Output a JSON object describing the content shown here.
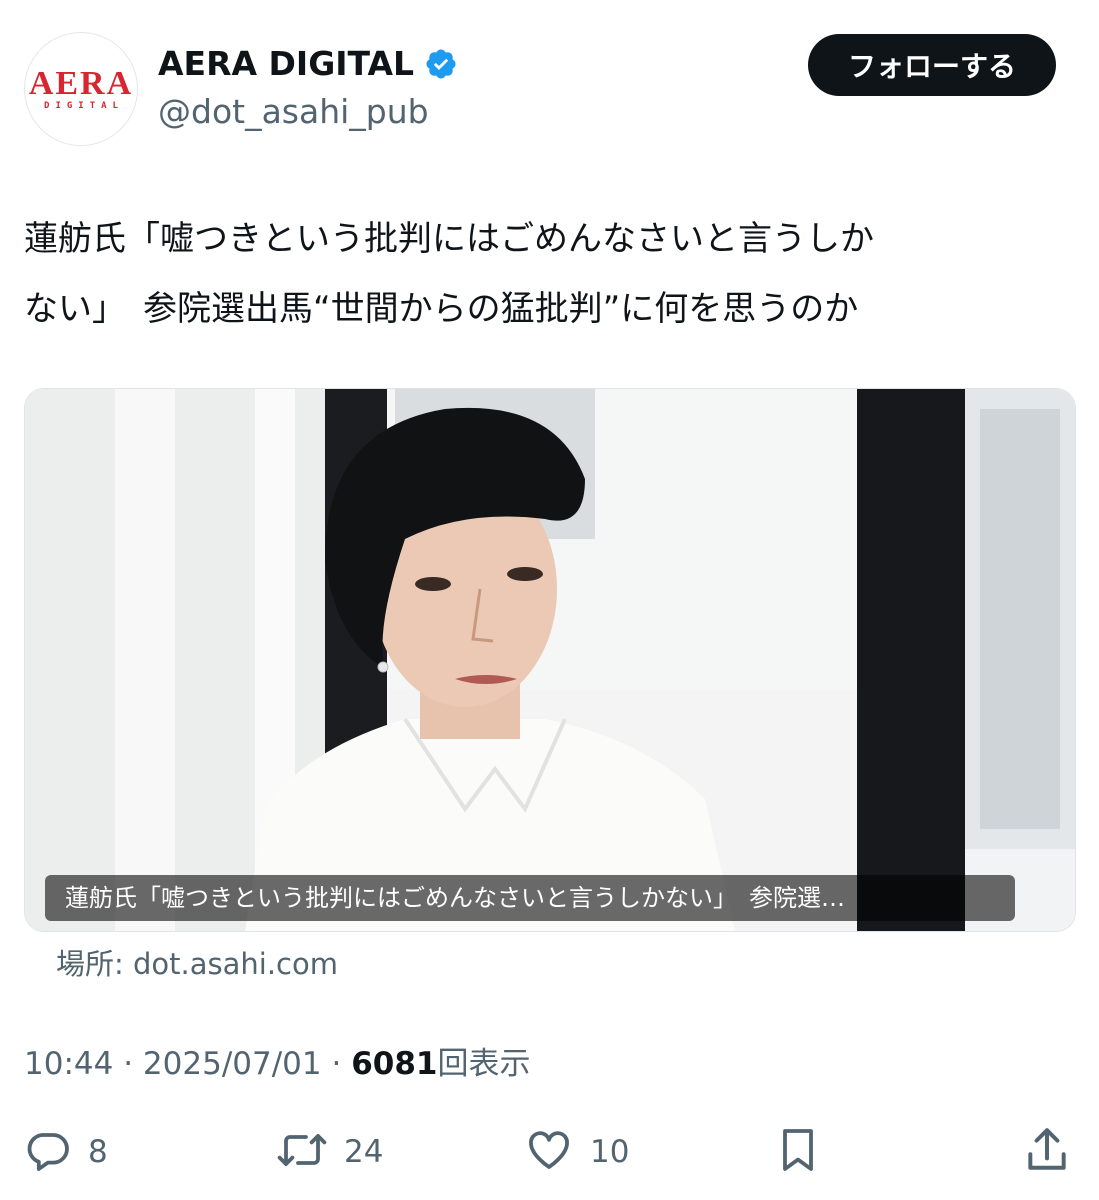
{
  "account": {
    "avatar_logo_main": "AERA",
    "avatar_logo_sub": "DIGITAL",
    "display_name": "AERA DIGITAL",
    "handle": "@dot_asahi_pub",
    "verified": true
  },
  "follow_button": {
    "label": "フォローする"
  },
  "tweet": {
    "text": "蓮舫氏「嘘つきという批判にはごめんなさいと言うしか\nない」　参院選出馬“世間からの猛批判”に何を思うのか"
  },
  "link_card": {
    "image_description_icon": "photo",
    "caption": "蓮舫氏「嘘つきという批判にはごめんなさいと言うしかない」　参院選…",
    "source_label": "場所: dot.asahi.com"
  },
  "meta": {
    "time": "10:44",
    "separator": "·",
    "date": "2025/07/01",
    "views_count": "6081",
    "views_label": "回表示"
  },
  "actions": {
    "reply_count": "8",
    "retweet_count": "24",
    "like_count": "10"
  },
  "colors": {
    "text_primary": "#0f1419",
    "text_secondary": "#536471",
    "verified_blue": "#1d9bf0",
    "logo_red": "#d7262f",
    "button_bg": "#0f1419"
  }
}
